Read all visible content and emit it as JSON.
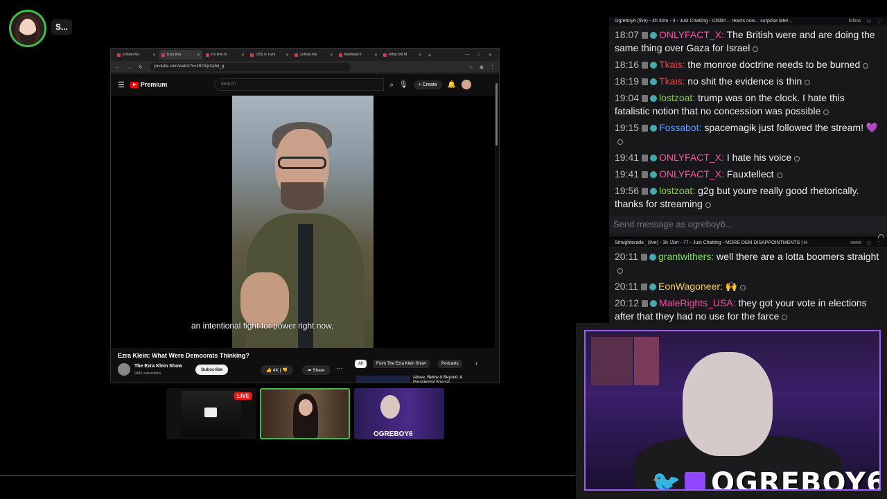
{
  "avatar_name": "S...",
  "browser": {
    "tabs": [
      "Zohran Ma",
      "Ezra Klei",
      "It's time fo",
      "CBS in Turm",
      "Zohran Ma",
      "Mamdani fi",
      "What Did M"
    ],
    "url": "youtube.com/watch?v=zRCEpXp5d_g",
    "youtube": {
      "logo": "Premium",
      "search_placeholder": "Search",
      "create_label": "+ Create",
      "caption": "an intentional fight for power right now,",
      "video_title": "Ezra Klein: What Were Democrats Thinking?",
      "channel_name": "The Ezra Klein Show",
      "channel_subs": "948K subscribers",
      "subscribe_label": "Subscribe",
      "like_label": "👍 4K  |  👎",
      "share_label": "➦ Share",
      "chips": [
        "All",
        "From The Ezra Klein Show",
        "Podcasts"
      ],
      "rec_title": "Above, Below & Beyond: A Presidential Special"
    }
  },
  "thumbs": {
    "live_badge": "LIVE",
    "thumb3_label": "OGREBOY6"
  },
  "chat1": {
    "header": "Ogreboy6 (live) - 4h 30m - 3 - Just Chatting - Chillin'... reacts now... surprise later...",
    "follow": "follow",
    "send_placeholder": "Send message as ogreboy6...",
    "messages": [
      {
        "time": "18:07",
        "user": "ONLYFACT_X:",
        "color": "u-pink",
        "text": "The British were and are doing the same thing over Gaza for Israel"
      },
      {
        "time": "18:16",
        "user": "Tkais:",
        "color": "u-red",
        "text": "the monroe doctrine needs to be burned"
      },
      {
        "time": "18:19",
        "user": "Tkais:",
        "color": "u-red",
        "text": "no shit the evidence is thin"
      },
      {
        "time": "19:04",
        "user": "lostzoat:",
        "color": "u-green",
        "text": "trump was on the clock. I hate this fatalistic notion that no concession was possible"
      },
      {
        "time": "19:15",
        "user": "Fossabot:",
        "color": "u-blue",
        "text": "spacemagik just followed the stream! 💜"
      },
      {
        "time": "19:41",
        "user": "ONLYFACT_X:",
        "color": "u-pink",
        "text": "I hate his voice"
      },
      {
        "time": "19:41",
        "user": "ONLYFACT_X:",
        "color": "u-pink",
        "text": "Fauxtellect"
      },
      {
        "time": "19:56",
        "user": "lostzoat:",
        "color": "u-green",
        "text": "g2g but youre really good rhetorically. thanks for streaming"
      }
    ]
  },
  "chat2": {
    "header": "Straighterade_ (live) - 3h 15m - 77 - Just Chatting - MORE DEM DISAPPOINTMENTS | H",
    "follow": "none",
    "messages": [
      {
        "time": "20:11",
        "user": "grantwithers:",
        "color": "u-lgreen",
        "text": "well there are a lotta boomers straight"
      },
      {
        "time": "20:11",
        "user": "EonWagoneer:",
        "color": "u-gold",
        "text": "🙌"
      },
      {
        "time": "20:12",
        "user": "MaleRights_USA:",
        "color": "u-pink",
        "text": "they got your vote in elections after that they had no use for the farce"
      }
    ]
  },
  "webcam": {
    "name": "OGREBOY6"
  }
}
